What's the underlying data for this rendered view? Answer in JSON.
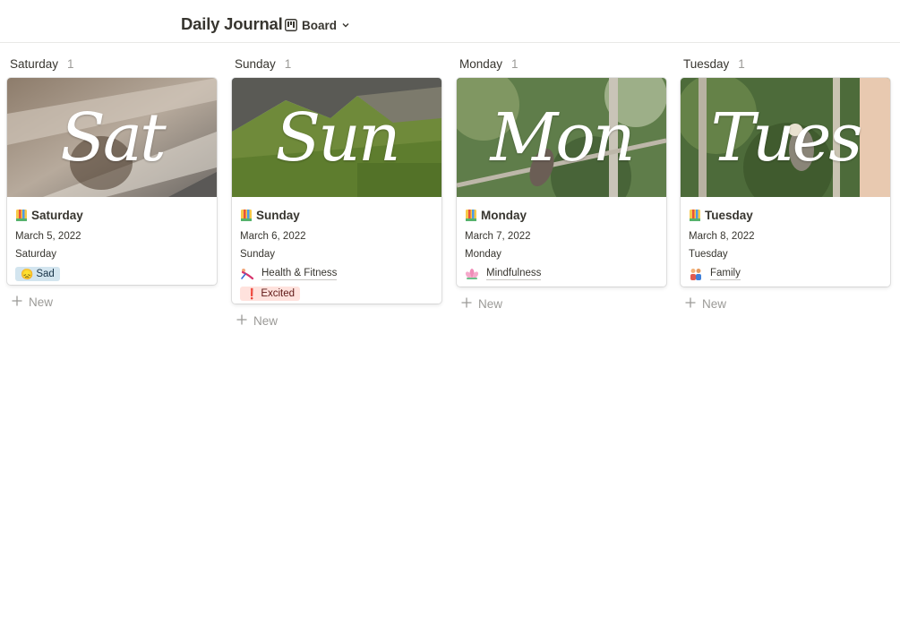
{
  "header": {
    "title": "Daily Journal",
    "view_label": "Board",
    "view_icon": "board-icon"
  },
  "columns": [
    {
      "name": "Saturday",
      "count": "1",
      "card": {
        "cover_word": "Sat",
        "title": "Saturday",
        "date": "March 5, 2022",
        "day": "Saturday",
        "tag": {
          "emoji": "😞",
          "label": "Sad"
        }
      },
      "new_label": "New"
    },
    {
      "name": "Sunday",
      "count": "1",
      "card": {
        "cover_word": "Sun",
        "title": "Sunday",
        "date": "March 6, 2022",
        "day": "Sunday",
        "relation": {
          "label": "Health & Fitness",
          "icon": "gymnast-icon"
        },
        "tag": {
          "emoji": "❗",
          "label": "Excited"
        }
      },
      "new_label": "New"
    },
    {
      "name": "Monday",
      "count": "1",
      "card": {
        "cover_word": "Mon",
        "title": "Monday",
        "date": "March 7, 2022",
        "day": "Monday",
        "relation": {
          "label": "Mindfulness",
          "icon": "lotus-icon"
        }
      },
      "new_label": "New"
    },
    {
      "name": "Tuesday",
      "count": "1",
      "card": {
        "cover_word": "Tues",
        "title": "Tuesday",
        "date": "March 8, 2022",
        "day": "Tuesday",
        "relation": {
          "label": "Family",
          "icon": "family-icon"
        }
      },
      "new_label": "New"
    }
  ],
  "colors": {
    "text": "#37352f",
    "muted": "#9b9a97",
    "sad_tag_bg": "#d3e5ef",
    "excited_tag_bg": "#ffe2dd"
  }
}
